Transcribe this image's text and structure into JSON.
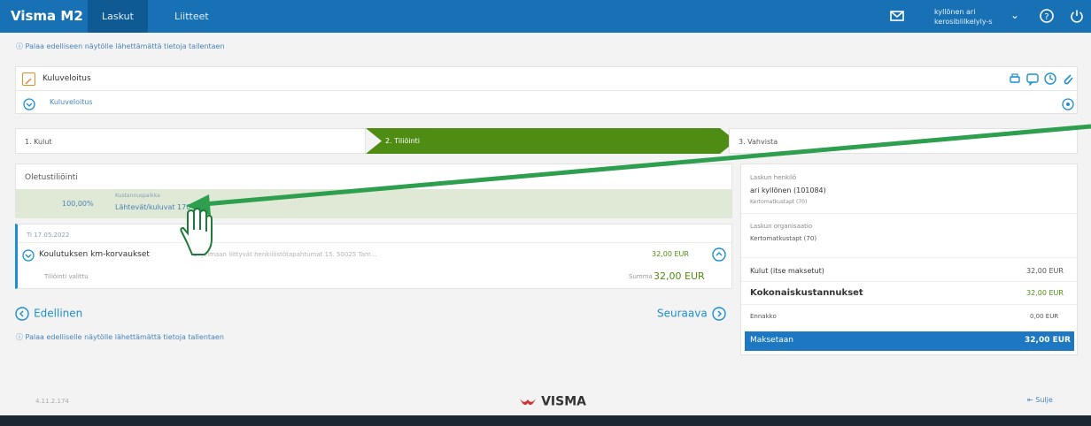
{
  "topbar": {
    "brand": "Visma M2",
    "tabs": [
      "Laskut",
      "Liitteet"
    ],
    "user_line1": "kyllönen ari",
    "user_line2": "kerosiblilkelyly-s",
    "user_chevron": "⌄"
  },
  "help": {
    "top": "Palaa edelliseen näytölle lähettämättä tietoja tallentaen",
    "bottom": "Palaa edelliselle näytölle lähettämättä tietoja tallentaen"
  },
  "header": {
    "title": "Kuluveloitus",
    "subtitle": "Kuluveloitus"
  },
  "stepper": {
    "step1": "1. Kulut",
    "step2": "2. Tiliöinti",
    "step3": "3. Vahvista"
  },
  "allocation": {
    "title": "Oletustiliöinti",
    "percent": "100,00%",
    "sub_label": "Kustannuspaikka",
    "sub_value": "Lähtevät/kuluvat 170"
  },
  "expense": {
    "date": "Ti 17.05.2022",
    "name": "Koulutuksen km-korvaukset",
    "desc": "Ohjelmaan liittyvät henkilöstötapahtumat 15. 50025 Tam...",
    "amount": "32,00 EUR",
    "status": "Tiliöinti valittu",
    "sum_label": "Summa",
    "sum_value": "32,00 EUR"
  },
  "nav": {
    "prev": "Edellinen",
    "next": "Seuraava"
  },
  "summary": {
    "invoicer_label": "Laskun henkilö",
    "invoicer_name": "ari kyllönen (101084)",
    "invoicer_cost": "Kertomatkustapt (70)",
    "org_label": "Laskun organisaatio",
    "org_value": "Kertomatkustapt (70)",
    "rows": [
      {
        "label": "Kulut (itse maksetut)",
        "value": "32,00 EUR"
      },
      {
        "label": "Kokonaiskustannukset",
        "value": "32,00 EUR"
      },
      {
        "label": "Ennakko",
        "value": "0,00 EUR"
      }
    ],
    "pay_label": "Maksetaan",
    "pay_value": "32,00 EUR"
  },
  "footer": {
    "version": "4.11.2.174",
    "logo": "VISMA",
    "logout": "Sulje"
  },
  "colors": {
    "brand_blue": "#1771b4",
    "step_green": "#4f8c13",
    "highlight_green": "#2e9e4f"
  }
}
